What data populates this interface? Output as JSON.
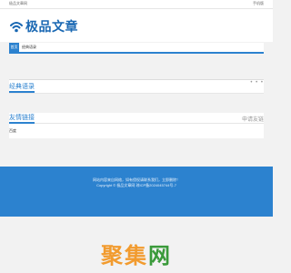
{
  "topbar": {
    "left_text": "极品文章网",
    "right_text": "手机版"
  },
  "header": {
    "logo_text": "极品文章",
    "logo_icon": "wifi-signal-icon",
    "brand_color": "#1a68b3"
  },
  "nav": {
    "items": [
      {
        "label": "首页",
        "active": true
      },
      {
        "label": "经典语录",
        "active": false
      }
    ],
    "accent_color": "#2c82cf"
  },
  "section_classic": {
    "title": "经典语录",
    "more": "• • •"
  },
  "section_links": {
    "title": "友情链接",
    "apply_label": "申请友链",
    "items": [
      {
        "label": "百度"
      }
    ]
  },
  "footer": {
    "line1": "网站内容来自网络，如有侵权请联系我们，立即删除！",
    "line2": "Copyright © 极品文章网 琼ICP备2024045744号-7",
    "bg_color": "#2c82cf"
  },
  "watermark": {
    "part_a": "聚集",
    "part_b": "网"
  }
}
